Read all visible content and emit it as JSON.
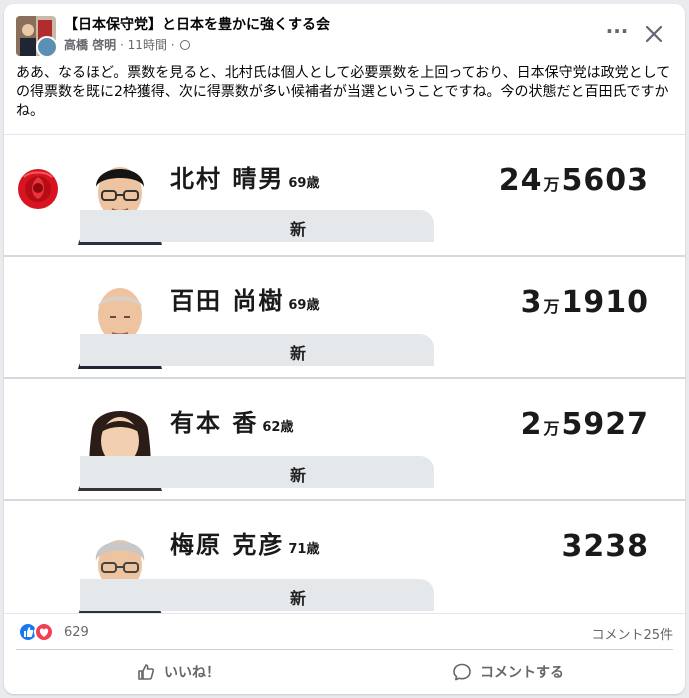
{
  "post": {
    "group_name": "【日本保守党】と日本を豊かに強くする会",
    "author": "高橋 啓明",
    "time": "11時間",
    "separator": "·",
    "body": "ああ、なるほど。票数を見ると、北村氏は個人として必要票数を上回っており、日本保守党は政党としての得票数を既に2枠獲得、次に得票数が多い候補者が当選ということですね。今の状態だと百田氏ですかね。"
  },
  "candidates": [
    {
      "name": "北村 晴男",
      "age": "69",
      "age_unit": "歳",
      "status": "新",
      "votes_man": "24",
      "man_unit": "万",
      "votes_rest": "5603"
    },
    {
      "name": "百田 尚樹",
      "age": "69",
      "age_unit": "歳",
      "status": "新",
      "votes_man": "3",
      "man_unit": "万",
      "votes_rest": "1910"
    },
    {
      "name": "有本 香",
      "age": "62",
      "age_unit": "歳",
      "status": "新",
      "votes_man": "2",
      "man_unit": "万",
      "votes_rest": "5927"
    },
    {
      "name": "梅原 克彦",
      "age": "71",
      "age_unit": "歳",
      "status": "新",
      "votes_man": "",
      "man_unit": "",
      "votes_rest": "3238"
    }
  ],
  "footer": {
    "reaction_count": "629",
    "comments_label": "コメント25件",
    "like_label": "いいね！",
    "comment_label": "コメントする"
  },
  "icons": {
    "more": "more-dots-icon",
    "close": "close-icon",
    "globe": "globe-icon",
    "rose": "rose-icon",
    "like_reaction": "like-reaction-icon",
    "love_reaction": "love-reaction-icon",
    "like": "thumbs-up-icon",
    "comment": "comment-bubble-icon"
  },
  "colors": {
    "like_blue": "#1877f2",
    "love_red": "#f33e58",
    "rose_red": "#d7141f",
    "new_bar": "#e4e8ea"
  }
}
